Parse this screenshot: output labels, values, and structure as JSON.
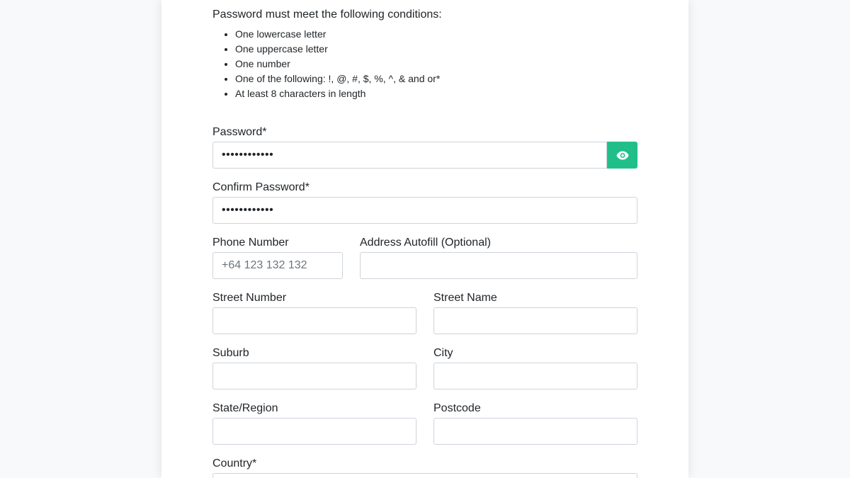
{
  "requirements": {
    "title": "Password must meet the following conditions:",
    "items": [
      "One lowercase letter",
      "One uppercase letter",
      "One number",
      "One of the following: !, @, #, $, %, ^, & and or*",
      "At least 8 characters in length"
    ]
  },
  "password": {
    "label": "Password*",
    "value": "••••••••••••",
    "toggle_icon": "eye-icon"
  },
  "confirm_password": {
    "label": "Confirm Password*",
    "value": "••••••••••••"
  },
  "phone": {
    "label": "Phone Number",
    "placeholder": "+64 123 132 132",
    "value": ""
  },
  "address_autofill": {
    "label": "Address Autofill (Optional)",
    "value": ""
  },
  "street_number": {
    "label": "Street Number",
    "value": ""
  },
  "street_name": {
    "label": "Street Name",
    "value": ""
  },
  "suburb": {
    "label": "Suburb",
    "value": ""
  },
  "city": {
    "label": "City",
    "value": ""
  },
  "state_region": {
    "label": "State/Region",
    "value": ""
  },
  "postcode": {
    "label": "Postcode",
    "value": ""
  },
  "country": {
    "label": "Country*"
  },
  "colors": {
    "accent": "#20bf8a",
    "page_background": "#f8f9fa",
    "input_border": "#ced4da"
  }
}
